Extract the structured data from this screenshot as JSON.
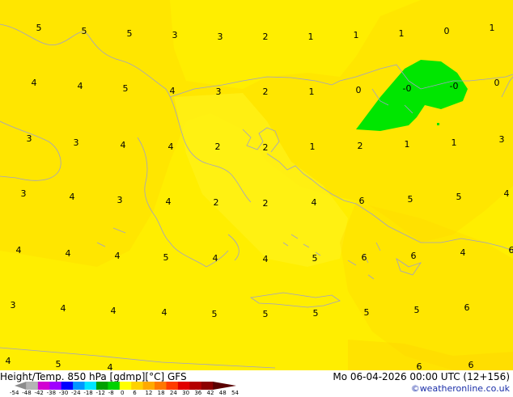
{
  "footer": {
    "title": "Height/Temp. 850 hPa [gdmp][°C] GFS",
    "date": "Mo 06-04-2026 00:00 UTC (12+156)",
    "credit": "©weatheronline.co.uk"
  },
  "colorbar": {
    "labels": [
      "-54",
      "-48",
      "-42",
      "-38",
      "-30",
      "-24",
      "-18",
      "-12",
      "-8",
      "0",
      "6",
      "12",
      "18",
      "24",
      "30",
      "36",
      "42",
      "48",
      "54"
    ],
    "colors": [
      "#8c8c8c",
      "#b4b4b4",
      "#d200d2",
      "#a000ff",
      "#0000ff",
      "#0096ff",
      "#00e6ff",
      "#00a000",
      "#00d200",
      "#ffff00",
      "#ffd200",
      "#ffaa00",
      "#ff7800",
      "#ff3c00",
      "#e10000",
      "#b40000",
      "#8c0000",
      "#5a0000"
    ]
  },
  "map": {
    "colors": {
      "base": "#ffee00",
      "warm": "#ffe000",
      "sea_pale": "#ffef10",
      "cold": "#00e600",
      "coast": "#a0a0c8"
    },
    "temperature_labels": [
      {
        "t": "5",
        "c": "5_a"
      },
      {
        "t": "5",
        "c": "5_b"
      },
      {
        "t": "5",
        "c": "5_c"
      },
      {
        "t": "3",
        "c": "3_a"
      },
      {
        "t": "3",
        "c": "3_b"
      },
      {
        "t": "2",
        "c": "2_a"
      },
      {
        "t": "1",
        "c": "1_a"
      },
      {
        "t": "1",
        "c": "1_b"
      },
      {
        "t": "1",
        "c": "1_c"
      },
      {
        "t": "0",
        "c": "0_a"
      },
      {
        "t": "1",
        "c": "1_d"
      },
      {
        "t": "4",
        "c": "r2_1"
      },
      {
        "t": "4",
        "c": "r2_2"
      },
      {
        "t": "5",
        "c": "r2_3"
      },
      {
        "t": "4",
        "c": "r2_4"
      },
      {
        "t": "3",
        "c": "r2_5"
      },
      {
        "t": "2",
        "c": "r2_6"
      },
      {
        "t": "1",
        "c": "r2_7"
      },
      {
        "t": "0",
        "c": "r2_8"
      },
      {
        "t": "-0",
        "c": "r2_9"
      },
      {
        "t": "-0",
        "c": "r2_10"
      },
      {
        "t": "0",
        "c": "r2_11"
      },
      {
        "t": "3",
        "c": "r3_1"
      },
      {
        "t": "3",
        "c": "r3_2"
      },
      {
        "t": "4",
        "c": "r3_3"
      },
      {
        "t": "4",
        "c": "r3_4"
      },
      {
        "t": "2",
        "c": "r3_5"
      },
      {
        "t": "2",
        "c": "r3_6"
      },
      {
        "t": "1",
        "c": "r3_7"
      },
      {
        "t": "2",
        "c": "r3_8"
      },
      {
        "t": "1",
        "c": "r3_9"
      },
      {
        "t": "1",
        "c": "r3_10"
      },
      {
        "t": "3",
        "c": "r3_11"
      },
      {
        "t": "3",
        "c": "r4_1"
      },
      {
        "t": "4",
        "c": "r4_2"
      },
      {
        "t": "3",
        "c": "r4_3"
      },
      {
        "t": "4",
        "c": "r4_4"
      },
      {
        "t": "2",
        "c": "r4_5"
      },
      {
        "t": "2",
        "c": "r4_6"
      },
      {
        "t": "4",
        "c": "r4_7"
      },
      {
        "t": "6",
        "c": "r4_8"
      },
      {
        "t": "5",
        "c": "r4_9"
      },
      {
        "t": "5",
        "c": "r4_10"
      },
      {
        "t": "4",
        "c": "r4_11"
      },
      {
        "t": "4",
        "c": "r5_1"
      },
      {
        "t": "4",
        "c": "r5_2"
      },
      {
        "t": "4",
        "c": "r5_3"
      },
      {
        "t": "5",
        "c": "r5_4"
      },
      {
        "t": "4",
        "c": "r5_5"
      },
      {
        "t": "4",
        "c": "r5_6"
      },
      {
        "t": "5",
        "c": "r5_7"
      },
      {
        "t": "6",
        "c": "r5_8"
      },
      {
        "t": "6",
        "c": "r5_9"
      },
      {
        "t": "4",
        "c": "r5_10"
      },
      {
        "t": "6",
        "c": "r5_11"
      },
      {
        "t": "3",
        "c": "r6_1"
      },
      {
        "t": "4",
        "c": "r6_2"
      },
      {
        "t": "4",
        "c": "r6_3"
      },
      {
        "t": "4",
        "c": "r6_4"
      },
      {
        "t": "5",
        "c": "r6_5"
      },
      {
        "t": "5",
        "c": "r6_6"
      },
      {
        "t": "5",
        "c": "r6_7"
      },
      {
        "t": "5",
        "c": "r6_8"
      },
      {
        "t": "5",
        "c": "r6_9"
      },
      {
        "t": "6",
        "c": "r6_10"
      },
      {
        "t": "4",
        "c": "r7_1"
      },
      {
        "t": "5",
        "c": "r7_2"
      },
      {
        "t": "4",
        "c": "r7_3"
      },
      {
        "t": "6",
        "c": "r7_4"
      },
      {
        "t": "6",
        "c": "r7_5"
      }
    ]
  }
}
